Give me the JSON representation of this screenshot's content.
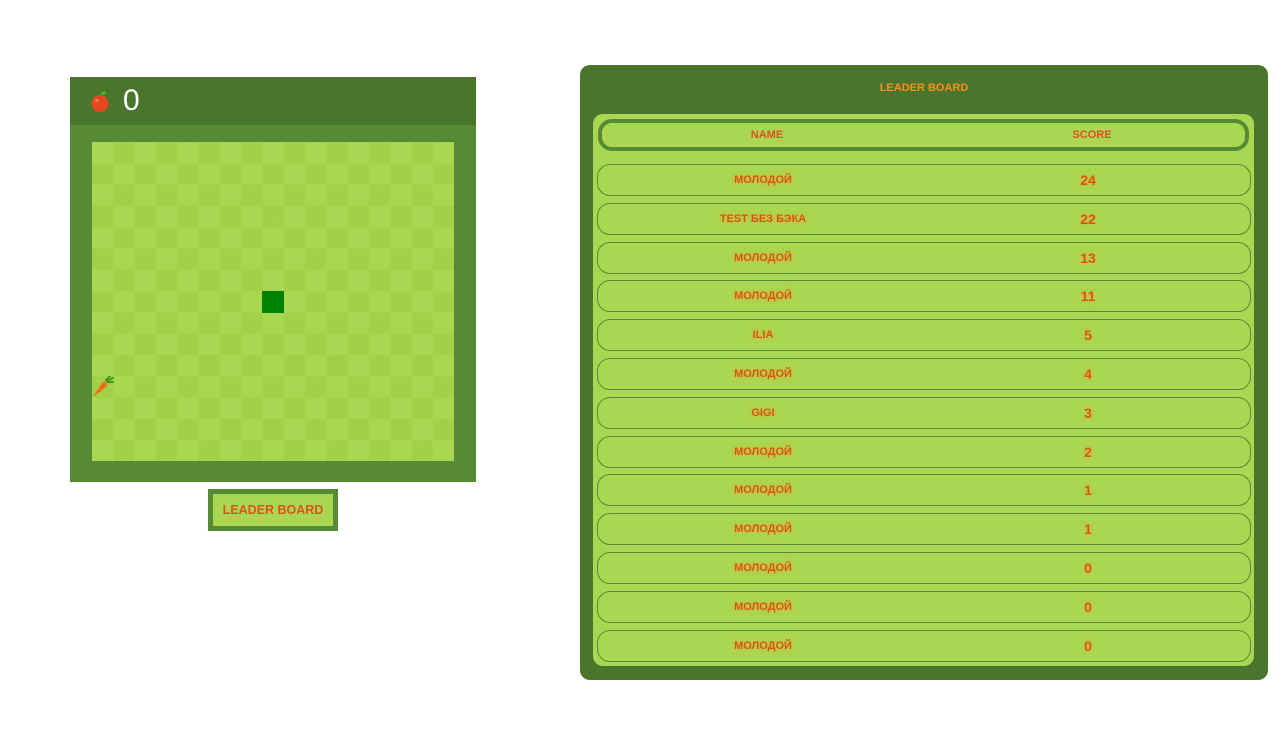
{
  "game": {
    "score": "0",
    "score_icon": "apple-icon",
    "food_icon": "carrot-icon",
    "colors": {
      "header": "#4a752c",
      "frame": "#578a34",
      "board_light": "#aad751",
      "board_dark": "#a2d149",
      "snake": "#008000"
    }
  },
  "leaderboard_button": {
    "label": "LEADER BOARD"
  },
  "leaderboard": {
    "title": "LEADER BOARD",
    "columns": {
      "name": "NAME",
      "score": "SCORE"
    },
    "rows": [
      {
        "name": "МОЛОДОЙ",
        "score": "24"
      },
      {
        "name": "TEST БЕЗ БЭКА",
        "score": "22"
      },
      {
        "name": "МОЛОДОЙ",
        "score": "13"
      },
      {
        "name": "МОЛОДОЙ",
        "score": "11"
      },
      {
        "name": "ILIA",
        "score": "5"
      },
      {
        "name": "МОЛОДОЙ",
        "score": "4"
      },
      {
        "name": "GIGI",
        "score": "3"
      },
      {
        "name": "МОЛОДОЙ",
        "score": "2"
      },
      {
        "name": "МОЛОДОЙ",
        "score": "1"
      },
      {
        "name": "МОЛОДОЙ",
        "score": "1"
      },
      {
        "name": "МОЛОДОЙ",
        "score": "0"
      },
      {
        "name": "МОЛОДОЙ",
        "score": "0"
      },
      {
        "name": "МОЛОДОЙ",
        "score": "0"
      }
    ],
    "colors": {
      "title": "#ff8c1a",
      "text": "#d9531e"
    }
  }
}
